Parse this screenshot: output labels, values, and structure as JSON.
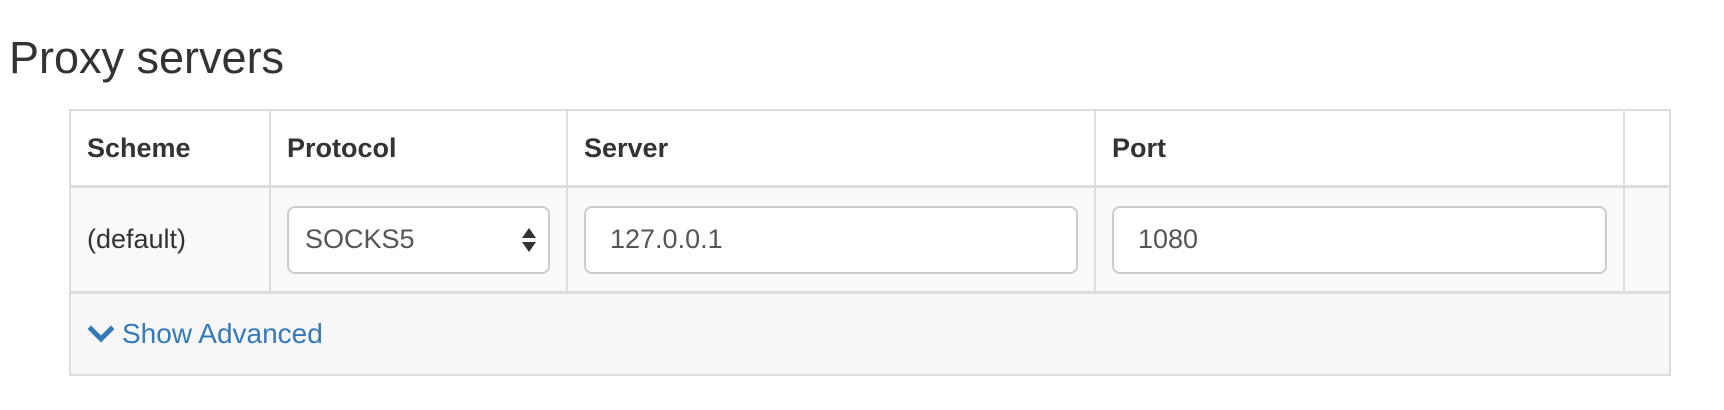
{
  "page": {
    "title": "Proxy servers"
  },
  "table": {
    "headers": {
      "scheme": "Scheme",
      "protocol": "Protocol",
      "server": "Server",
      "port": "Port"
    },
    "rows": [
      {
        "scheme": "(default)",
        "protocol": "SOCKS5",
        "server": "127.0.0.1",
        "port": "1080"
      }
    ]
  },
  "footer": {
    "show_advanced_label": "Show Advanced",
    "icon": "chevron-down-icon"
  },
  "colors": {
    "link": "#337ab7",
    "border": "#dddddd",
    "text": "#333333"
  }
}
